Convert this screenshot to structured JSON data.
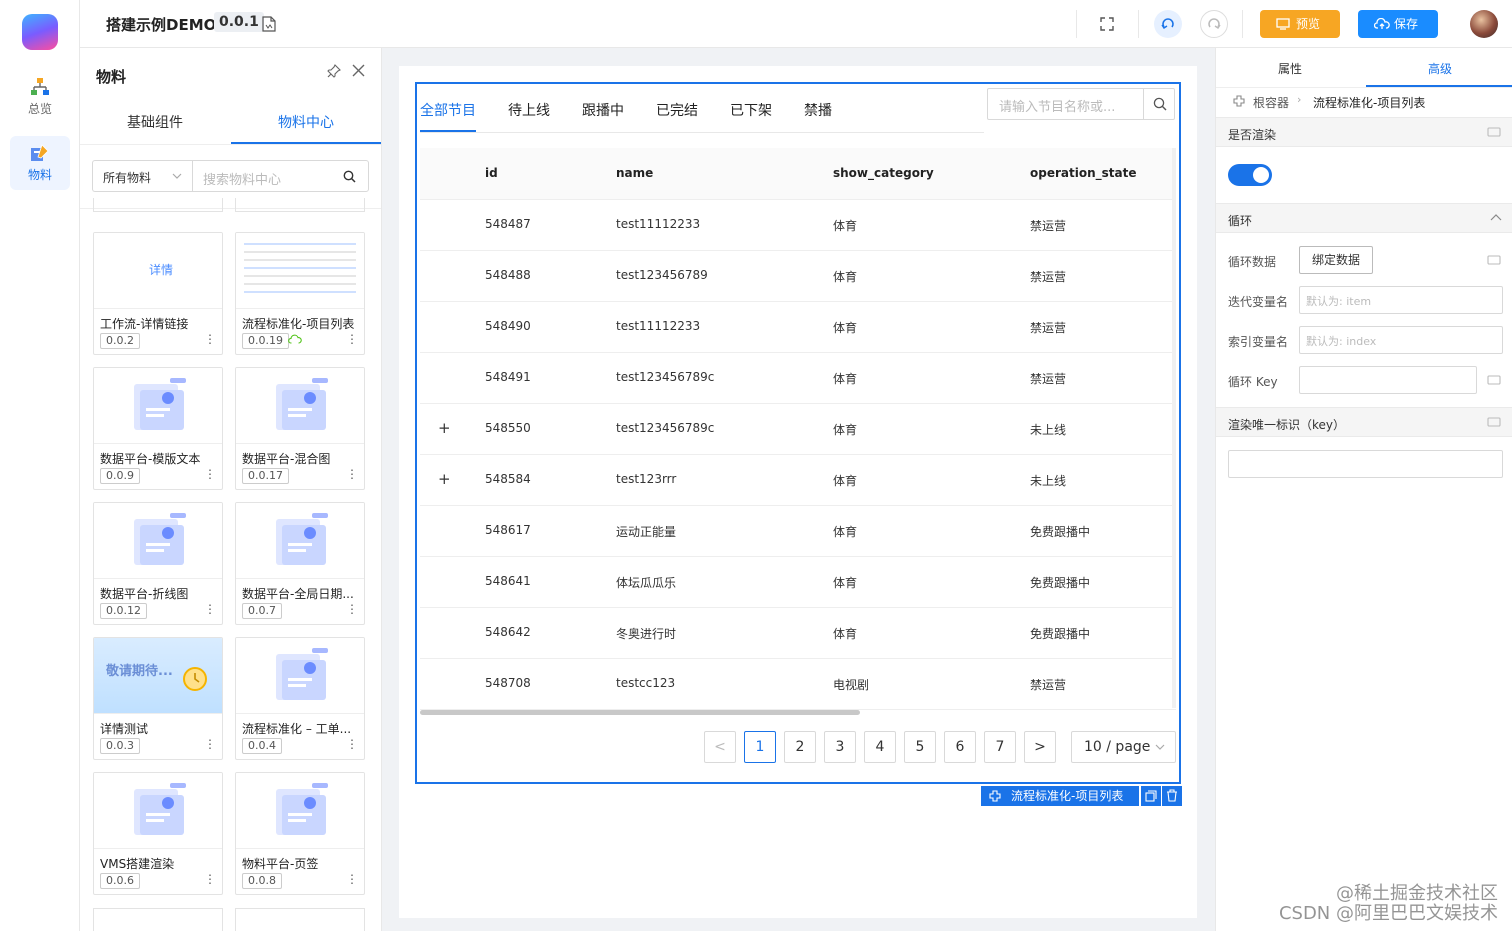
{
  "app": {
    "title": "搭建示例DEMO",
    "version": "0.0.1"
  },
  "rail": {
    "items": [
      {
        "label": "总览"
      },
      {
        "label": "物料"
      }
    ]
  },
  "topbar": {
    "preview_label": "预览",
    "save_label": "保存",
    "preview_color": "#f7a623",
    "save_color": "#1a8cff"
  },
  "materials": {
    "title": "物料",
    "tabs": [
      "基础组件",
      "物料中心"
    ],
    "active_tab": "物料中心",
    "filter_select": "所有物料",
    "search_placeholder": "搜索物料中心",
    "cards": [
      {
        "name": "工作流-详情链接",
        "version": "0.0.2",
        "thumb_text": "详情"
      },
      {
        "name": "流程标准化-项目列表",
        "version": "0.0.19"
      },
      {
        "name": "数据平台-模版文本",
        "version": "0.0.9"
      },
      {
        "name": "数据平台-混合图",
        "version": "0.0.17"
      },
      {
        "name": "数据平台-折线图",
        "version": "0.0.12"
      },
      {
        "name": "数据平台-全局日期...",
        "version": "0.0.7"
      },
      {
        "name": "详情测试",
        "version": "0.0.3",
        "thumb_text": "敬请期待..."
      },
      {
        "name": "流程标准化 – 工单...",
        "version": "0.0.4"
      },
      {
        "name": "VMS搭建渲染",
        "version": "0.0.6"
      },
      {
        "name": "物料平台-页签",
        "version": "0.0.8"
      }
    ]
  },
  "canvas": {
    "tabs": [
      "全部节目",
      "待上线",
      "跟播中",
      "已完结",
      "已下架",
      "禁播"
    ],
    "active_tab": "全部节目",
    "search_placeholder": "请输入节目名称或...",
    "columns": [
      "id",
      "name",
      "show_category",
      "operation_state"
    ],
    "rows": [
      {
        "expand": "",
        "id": "548487",
        "name": "test11112233",
        "category": "体育",
        "state": "禁运营"
      },
      {
        "expand": "",
        "id": "548488",
        "name": "test123456789",
        "category": "体育",
        "state": "禁运营"
      },
      {
        "expand": "",
        "id": "548490",
        "name": "test11112233",
        "category": "体育",
        "state": "禁运营"
      },
      {
        "expand": "",
        "id": "548491",
        "name": "test123456789c",
        "category": "体育",
        "state": "禁运营"
      },
      {
        "expand": "+",
        "id": "548550",
        "name": "test123456789c",
        "category": "体育",
        "state": "未上线"
      },
      {
        "expand": "+",
        "id": "548584",
        "name": "test123rrr",
        "category": "体育",
        "state": "未上线"
      },
      {
        "expand": "",
        "id": "548617",
        "name": "运动正能量",
        "category": "体育",
        "state": "免费跟播中"
      },
      {
        "expand": "",
        "id": "548641",
        "name": "体坛瓜瓜乐",
        "category": "体育",
        "state": "免费跟播中"
      },
      {
        "expand": "",
        "id": "548642",
        "name": "冬奥进行时",
        "category": "体育",
        "state": "免费跟播中"
      },
      {
        "expand": "",
        "id": "548708",
        "name": "testcc123",
        "category": "电视剧",
        "state": "禁运营"
      }
    ],
    "pagination": {
      "prev": "<",
      "pages": [
        "1",
        "2",
        "3",
        "4",
        "5",
        "6",
        "7"
      ],
      "current": "1",
      "next": ">",
      "page_size": "10 / page"
    },
    "selected_component": "流程标准化-项目列表"
  },
  "props": {
    "tabs": [
      "属性",
      "高级"
    ],
    "active_tab": "高级",
    "breadcrumb": [
      "根容器",
      "流程标准化-项目列表"
    ],
    "render_section": "是否渲染",
    "render_toggle": true,
    "loop_section": "循环",
    "loop_data_label": "循环数据",
    "bind_button": "绑定数据",
    "iter_var_label": "迭代变量名",
    "iter_var_placeholder": "默认为: item",
    "index_var_label": "索引变量名",
    "index_var_placeholder": "默认为: index",
    "loop_key_label": "循环 Key",
    "key_section": "渲染唯一标识（key）"
  },
  "watermark": {
    "line1": "@稀土掘金技术社区",
    "line2": "CSDN @阿里巴巴文娱技术"
  }
}
